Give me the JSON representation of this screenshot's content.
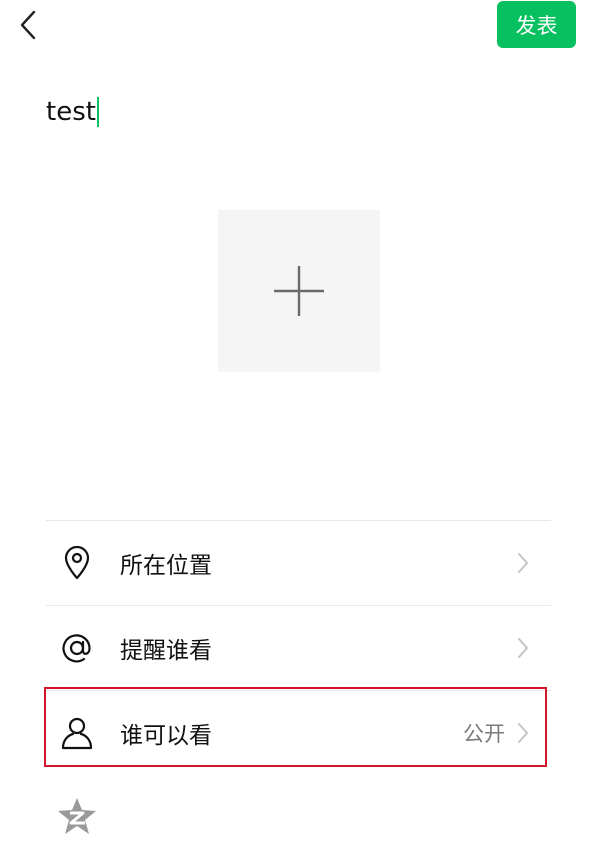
{
  "header": {
    "back_icon": "chevron-left-icon",
    "publish_label": "发表",
    "accent_color": "#07c160"
  },
  "compose": {
    "text_value": "test",
    "add_photo_icon": "plus-icon"
  },
  "options": [
    {
      "icon": "location-pin-icon",
      "label": "所在位置",
      "value": ""
    },
    {
      "icon": "at-icon",
      "label": "提醒谁看",
      "value": ""
    },
    {
      "icon": "person-icon",
      "label": "谁可以看",
      "value": "公开"
    }
  ],
  "footer": {
    "qzone_icon": "qzone-star-icon"
  },
  "highlight_color": "#d3152c"
}
